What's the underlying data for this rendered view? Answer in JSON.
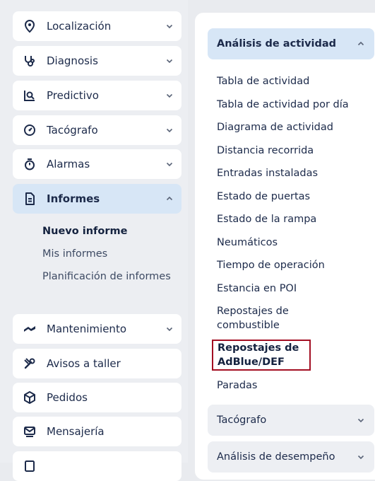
{
  "sidebar": {
    "items": [
      {
        "label": "Localización",
        "icon": "location-pin-icon",
        "expandable": true
      },
      {
        "label": "Diagnosis",
        "icon": "stethoscope-icon",
        "expandable": true
      },
      {
        "label": "Predictivo",
        "icon": "predictive-chart-icon",
        "expandable": true
      },
      {
        "label": "Tacógrafo",
        "icon": "tachograph-icon",
        "expandable": true
      },
      {
        "label": "Alarmas",
        "icon": "stopwatch-icon",
        "expandable": true
      },
      {
        "label": "Informes",
        "icon": "document-icon",
        "expandable": true,
        "expanded": true
      },
      {
        "label": "Mantenimiento",
        "icon": "maintenance-icon",
        "expandable": true
      },
      {
        "label": "Avisos a taller",
        "icon": "tools-icon",
        "expandable": false
      },
      {
        "label": "Pedidos",
        "icon": "package-icon",
        "expandable": false
      },
      {
        "label": "Mensajería",
        "icon": "messaging-icon",
        "expandable": false
      }
    ],
    "informes_submenu": [
      {
        "label": "Nuevo informe",
        "active": true
      },
      {
        "label": "Mis informes",
        "active": false
      },
      {
        "label": "Planificación de informes",
        "active": false
      }
    ]
  },
  "panel": {
    "open_section": "Análisis de actividad",
    "reports": [
      "Tabla de actividad",
      "Tabla de actividad por día",
      "Diagrama de actividad",
      "Distancia recorrida",
      "Entradas instaladas",
      "Estado de puertas",
      "Estado de la rampa",
      "Neumáticos",
      "Tiempo de operación",
      "Estancia en POI",
      "Repostajes de combustible",
      "Repostajes de AdBlue/DEF",
      "Paradas"
    ],
    "highlighted_report": "Repostajes de AdBlue/DEF",
    "closed_sections": [
      "Tacógrafo",
      "Análisis de desempeño"
    ]
  },
  "colors": {
    "accent_bg": "#d7e6f6",
    "text": "#1c2a4a",
    "highlight_border": "#a30f23"
  }
}
